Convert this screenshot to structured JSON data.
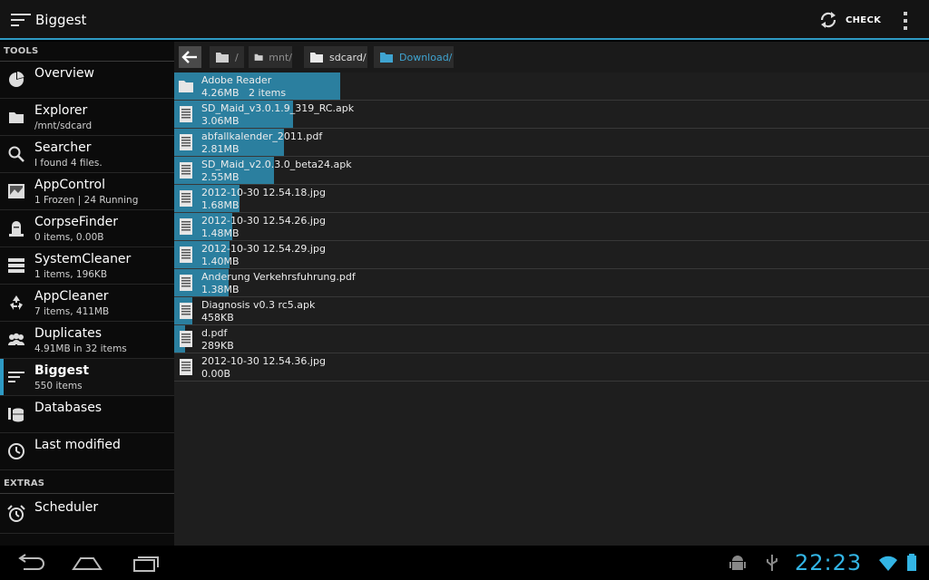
{
  "actionbar": {
    "title": "Biggest",
    "check_label": "CHECK"
  },
  "sidebar": {
    "tools_header": "TOOLS",
    "extras_header": "EXTRAS",
    "items": [
      {
        "label": "Overview",
        "sub": "",
        "icon": "pie-chart-icon"
      },
      {
        "label": "Explorer",
        "sub": "/mnt/sdcard",
        "icon": "folder-icon"
      },
      {
        "label": "Searcher",
        "sub": "I found 4 files.",
        "icon": "search-icon"
      },
      {
        "label": "AppControl",
        "sub": "1 Frozen | 24 Running",
        "icon": "app-control-icon"
      },
      {
        "label": "CorpseFinder",
        "sub": "0 items, 0.00B",
        "icon": "gravestone-icon"
      },
      {
        "label": "SystemCleaner",
        "sub": "1 items, 196KB",
        "icon": "system-cleaner-icon"
      },
      {
        "label": "AppCleaner",
        "sub": "7 items, 411MB",
        "icon": "recycle-icon"
      },
      {
        "label": "Duplicates",
        "sub": "4.91MB in 32 items",
        "icon": "duplicates-icon"
      },
      {
        "label": "Biggest",
        "sub": "550 items",
        "icon": "biggest-icon"
      },
      {
        "label": "Databases",
        "sub": "",
        "icon": "database-icon"
      },
      {
        "label": "Last modified",
        "sub": "",
        "icon": "clock-icon"
      }
    ],
    "extras": [
      {
        "label": "Scheduler",
        "sub": "",
        "icon": "alarm-icon"
      }
    ]
  },
  "breadcrumb": [
    "/",
    "mnt/",
    "sdcard/",
    "Download/"
  ],
  "files": [
    {
      "name": "Adobe Reader",
      "size": "4.26MB",
      "extra": "2 items",
      "type": "folder",
      "fraction": 0.22
    },
    {
      "name": "SD_Maid_v3.0.1.9_319_RC.apk",
      "size": "3.06MB",
      "type": "file",
      "fraction": 0.157
    },
    {
      "name": "abfallkalender_2011.pdf",
      "size": "2.81MB",
      "type": "file",
      "fraction": 0.145
    },
    {
      "name": "SD_Maid_v2.0.3.0_beta24.apk",
      "size": "2.55MB",
      "type": "file",
      "fraction": 0.132
    },
    {
      "name": "2012-10-30 12.54.18.jpg",
      "size": "1.68MB",
      "type": "file",
      "fraction": 0.087
    },
    {
      "name": "2012-10-30 12.54.26.jpg",
      "size": "1.48MB",
      "type": "file",
      "fraction": 0.077
    },
    {
      "name": "2012-10-30 12.54.29.jpg",
      "size": "1.40MB",
      "type": "file",
      "fraction": 0.073
    },
    {
      "name": "Anderung Verkehrsfuhrung.pdf",
      "size": "1.38MB",
      "type": "file",
      "fraction": 0.072
    },
    {
      "name": "Diagnosis v0.3 rc5.apk",
      "size": "458KB",
      "type": "file",
      "fraction": 0.024
    },
    {
      "name": "d.pdf",
      "size": "289KB",
      "type": "file",
      "fraction": 0.015
    },
    {
      "name": "2012-10-30 12.54.36.jpg",
      "size": "0.00B",
      "type": "file",
      "fraction": 0
    }
  ],
  "status": {
    "clock": "22:23"
  },
  "colors": {
    "accent": "#2e9ac4",
    "bar": "#2b7f9f",
    "clock": "#33b5e5"
  }
}
